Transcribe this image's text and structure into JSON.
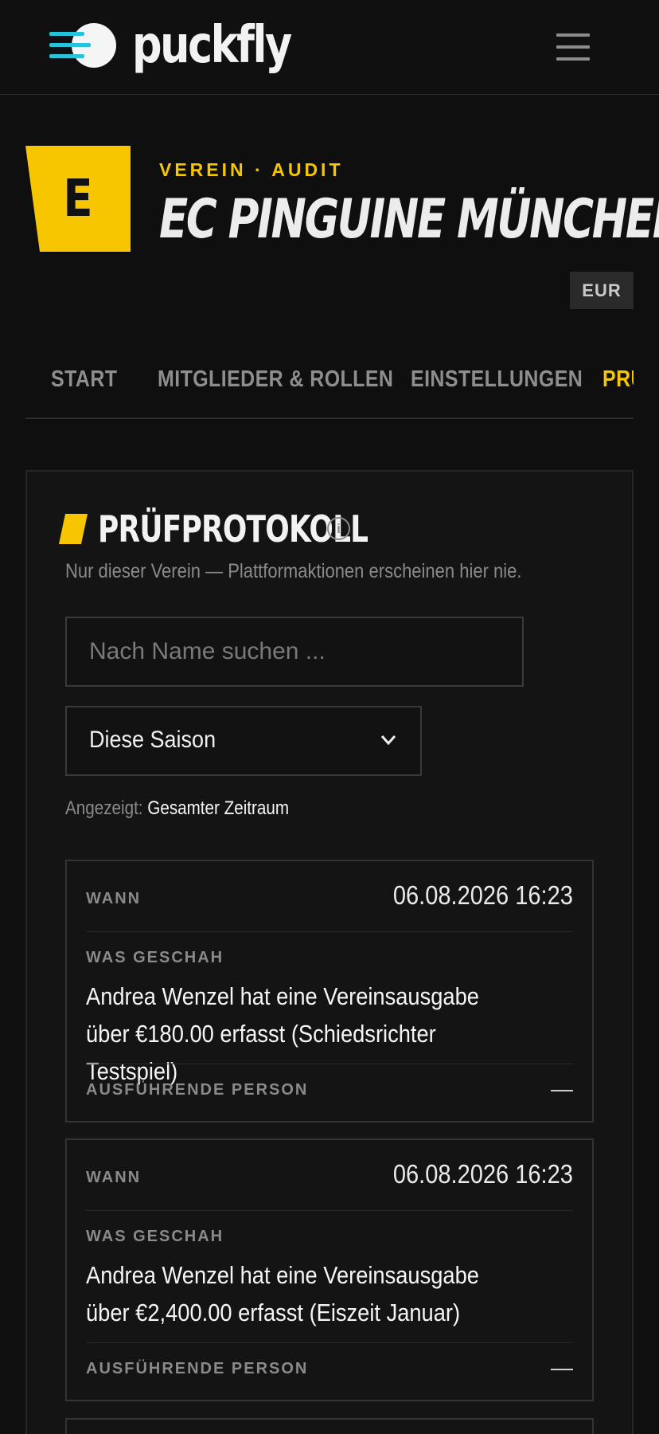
{
  "brand": {
    "name": "puckfly"
  },
  "club": {
    "badge_letter": "E",
    "eyebrow": "VEREIN · AUDIT",
    "name": "EC PINGUINE MÜNCHEN E.V.",
    "currency": "EUR"
  },
  "tabs": [
    {
      "label": "START",
      "active": false
    },
    {
      "label": "MITGLIEDER & ROLLEN",
      "active": false
    },
    {
      "label": "EINSTELLUNGEN",
      "active": false
    },
    {
      "label": "PRÜ",
      "active": true
    }
  ],
  "section": {
    "title": "PRÜFPROTOKOLL",
    "subtitle": "Nur dieser Verein — Plattformaktionen erscheinen hier nie."
  },
  "filters": {
    "search_placeholder": "Nach Name suchen ...",
    "period_selected": "Diese Saison",
    "shown_label": "Angezeigt:",
    "shown_value": "Gesamter Zeitraum"
  },
  "labels": {
    "when": "WANN",
    "what": "WAS GESCHAH",
    "actor": "AUSFÜHRENDE PERSON"
  },
  "entries": [
    {
      "when": "06.08.2026 16:23",
      "what": "Andrea Wenzel hat eine Vereinsausgabe über €180.00 erfasst (Schiedsrichter Testspiel)",
      "actor": "—"
    },
    {
      "when": "06.08.2026 16:23",
      "what": "Andrea Wenzel hat eine Vereinsausgabe über €2,400.00 erfasst (Eiszeit Januar)",
      "actor": "—"
    }
  ],
  "colors": {
    "background": "#0f0f0f",
    "accent_yellow": "#f7c600",
    "logo_cyan": "#27c2dc"
  }
}
